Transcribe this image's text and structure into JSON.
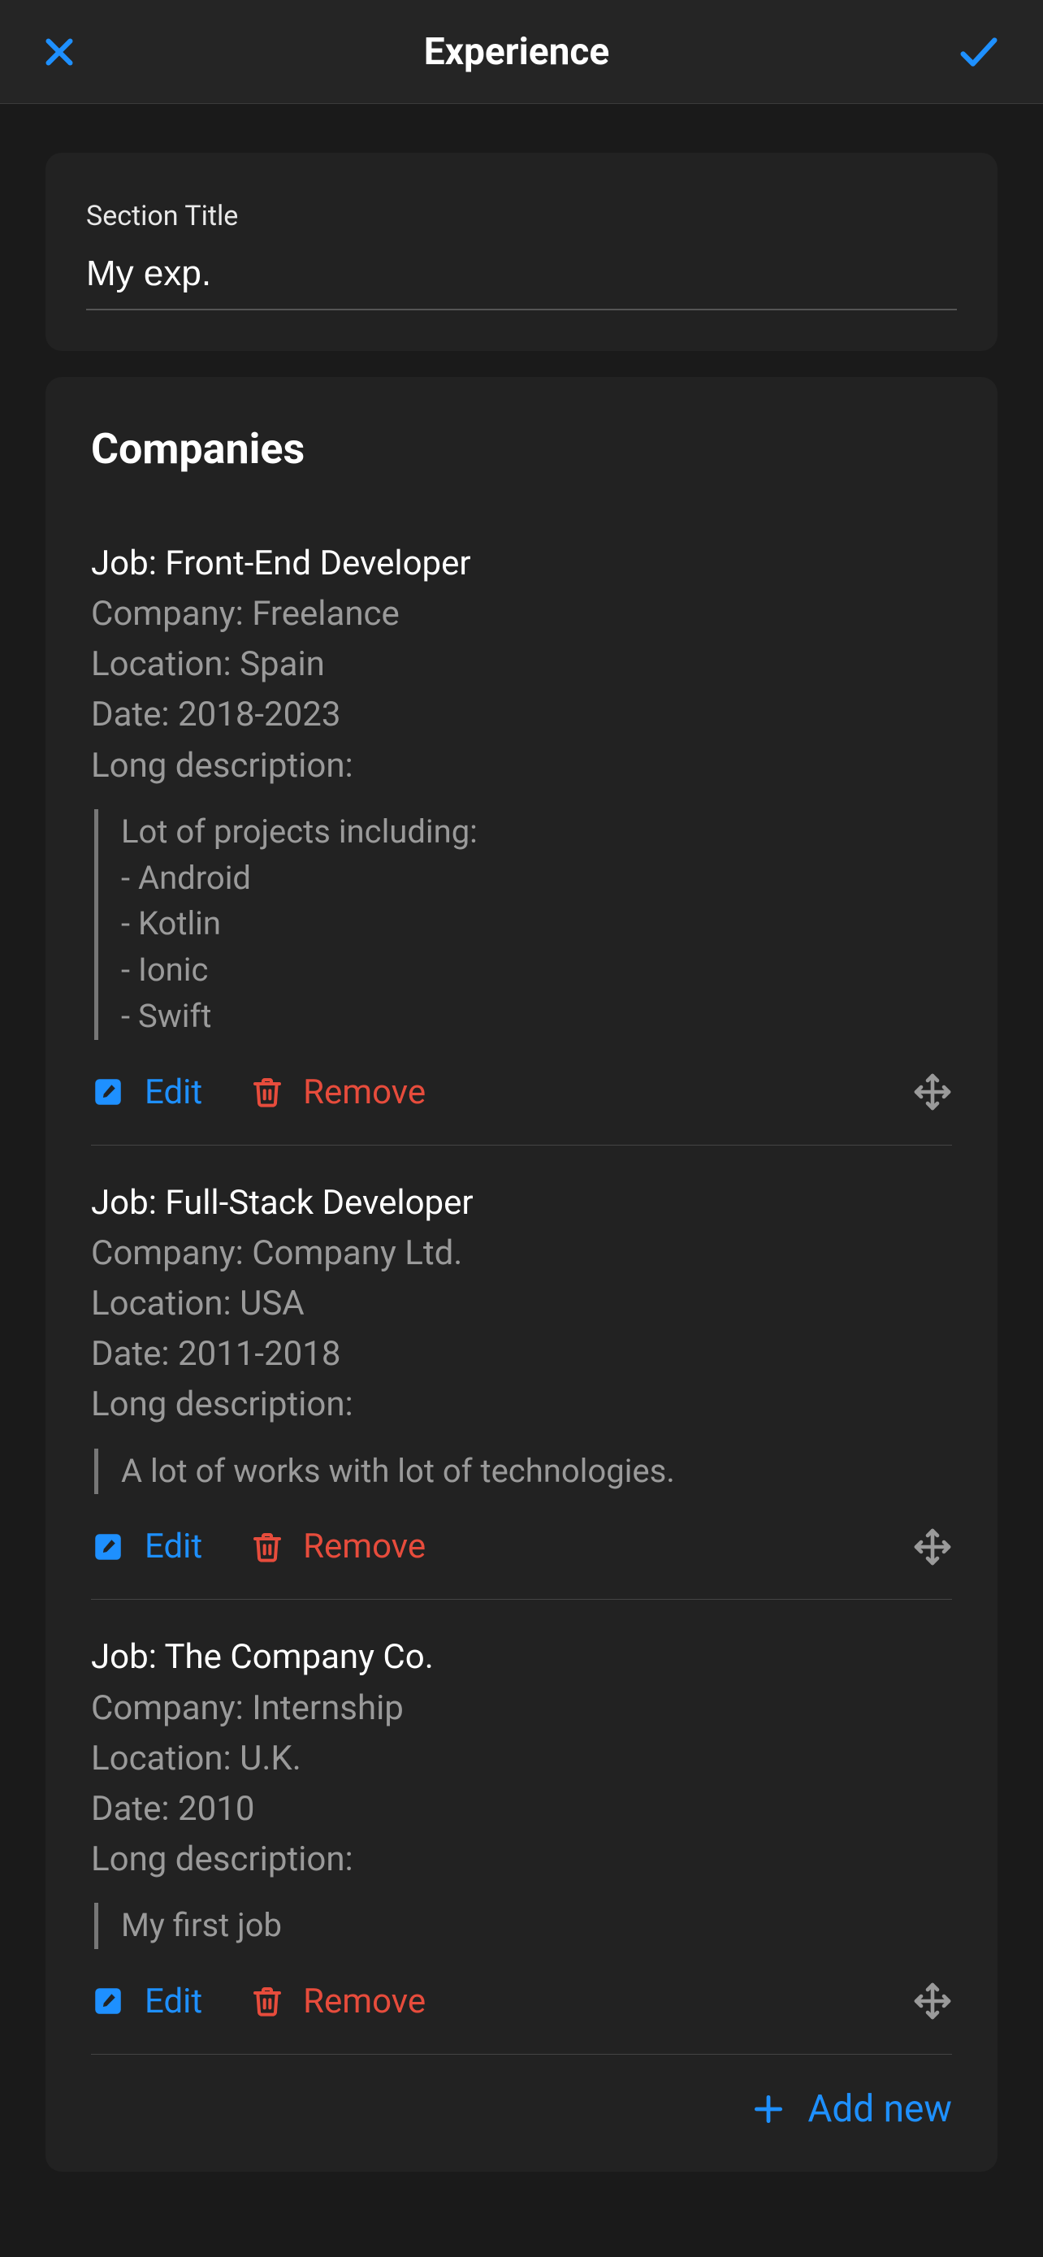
{
  "header": {
    "title": "Experience"
  },
  "sectionTitle": {
    "label": "Section Title",
    "value": "My exp."
  },
  "companies": {
    "heading": "Companies",
    "labels": {
      "job": "Job: ",
      "company": "Company: ",
      "location": "Location: ",
      "date": "Date: ",
      "longDesc": "Long description:",
      "edit": "Edit",
      "remove": "Remove",
      "addNew": "Add new"
    },
    "items": [
      {
        "job": "Front-End Developer",
        "company": "Freelance",
        "location": "Spain",
        "date": "2018-2023",
        "description": "Lot of projects including:\n- Android\n- Kotlin\n- Ionic\n- Swift"
      },
      {
        "job": "Full-Stack Developer",
        "company": "Company Ltd.",
        "location": "USA",
        "date": "2011-2018",
        "description": "A lot of works with lot of technologies."
      },
      {
        "job": "The Company Co.",
        "company": "Internship",
        "location": "U.K.",
        "date": "2010",
        "description": "My first job"
      }
    ]
  },
  "colors": {
    "accent": "#1E90FF",
    "danger": "#E74C3C",
    "muted": "#9a9a9a",
    "bg": "#1a1a1a",
    "card": "#222222"
  }
}
